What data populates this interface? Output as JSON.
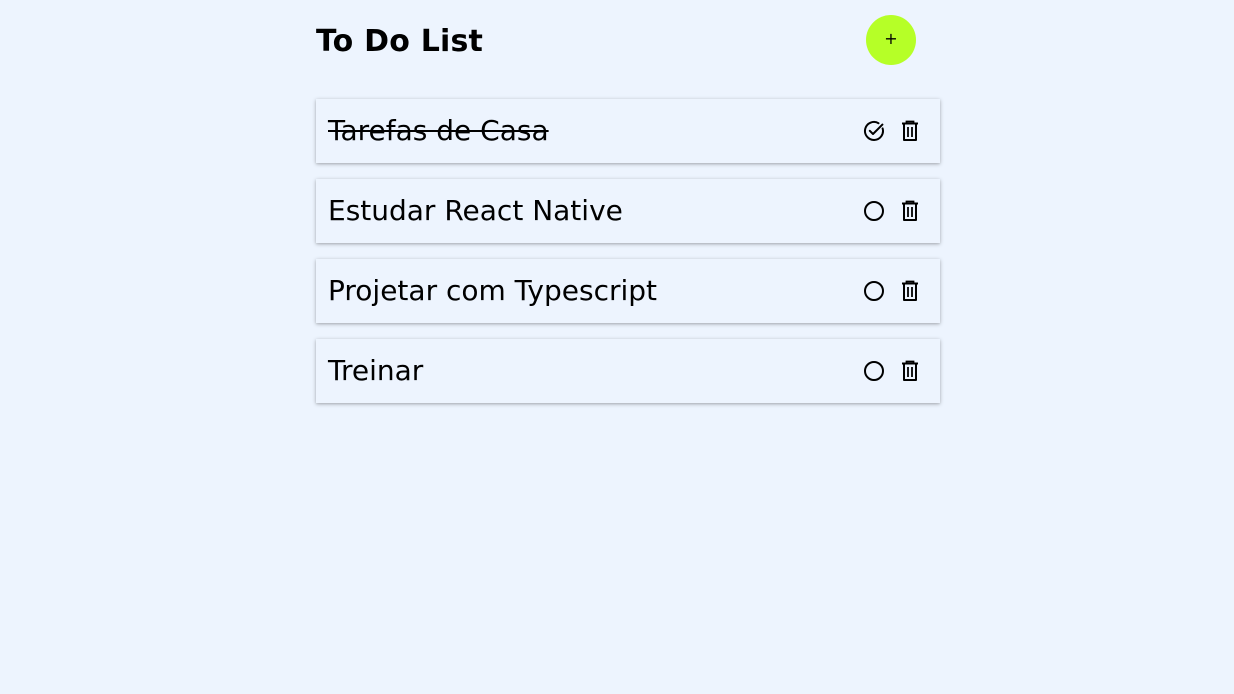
{
  "page": {
    "title": "To Do List"
  },
  "add_button": {
    "label": "+",
    "color": "#b6ff27"
  },
  "tasks": [
    {
      "label": "Tarefas de Casa",
      "completed": true,
      "status_icon": "check-circle-icon",
      "delete_icon": "trash-icon"
    },
    {
      "label": "Estudar React Native",
      "completed": false,
      "status_icon": "circle-icon",
      "delete_icon": "trash-icon"
    },
    {
      "label": "Projetar com Typescript",
      "completed": false,
      "status_icon": "circle-icon",
      "delete_icon": "trash-icon"
    },
    {
      "label": "Treinar",
      "completed": false,
      "status_icon": "circle-icon",
      "delete_icon": "trash-icon"
    }
  ],
  "colors": {
    "background": "#edf4fe",
    "accent": "#b6ff27",
    "text": "#000000"
  }
}
